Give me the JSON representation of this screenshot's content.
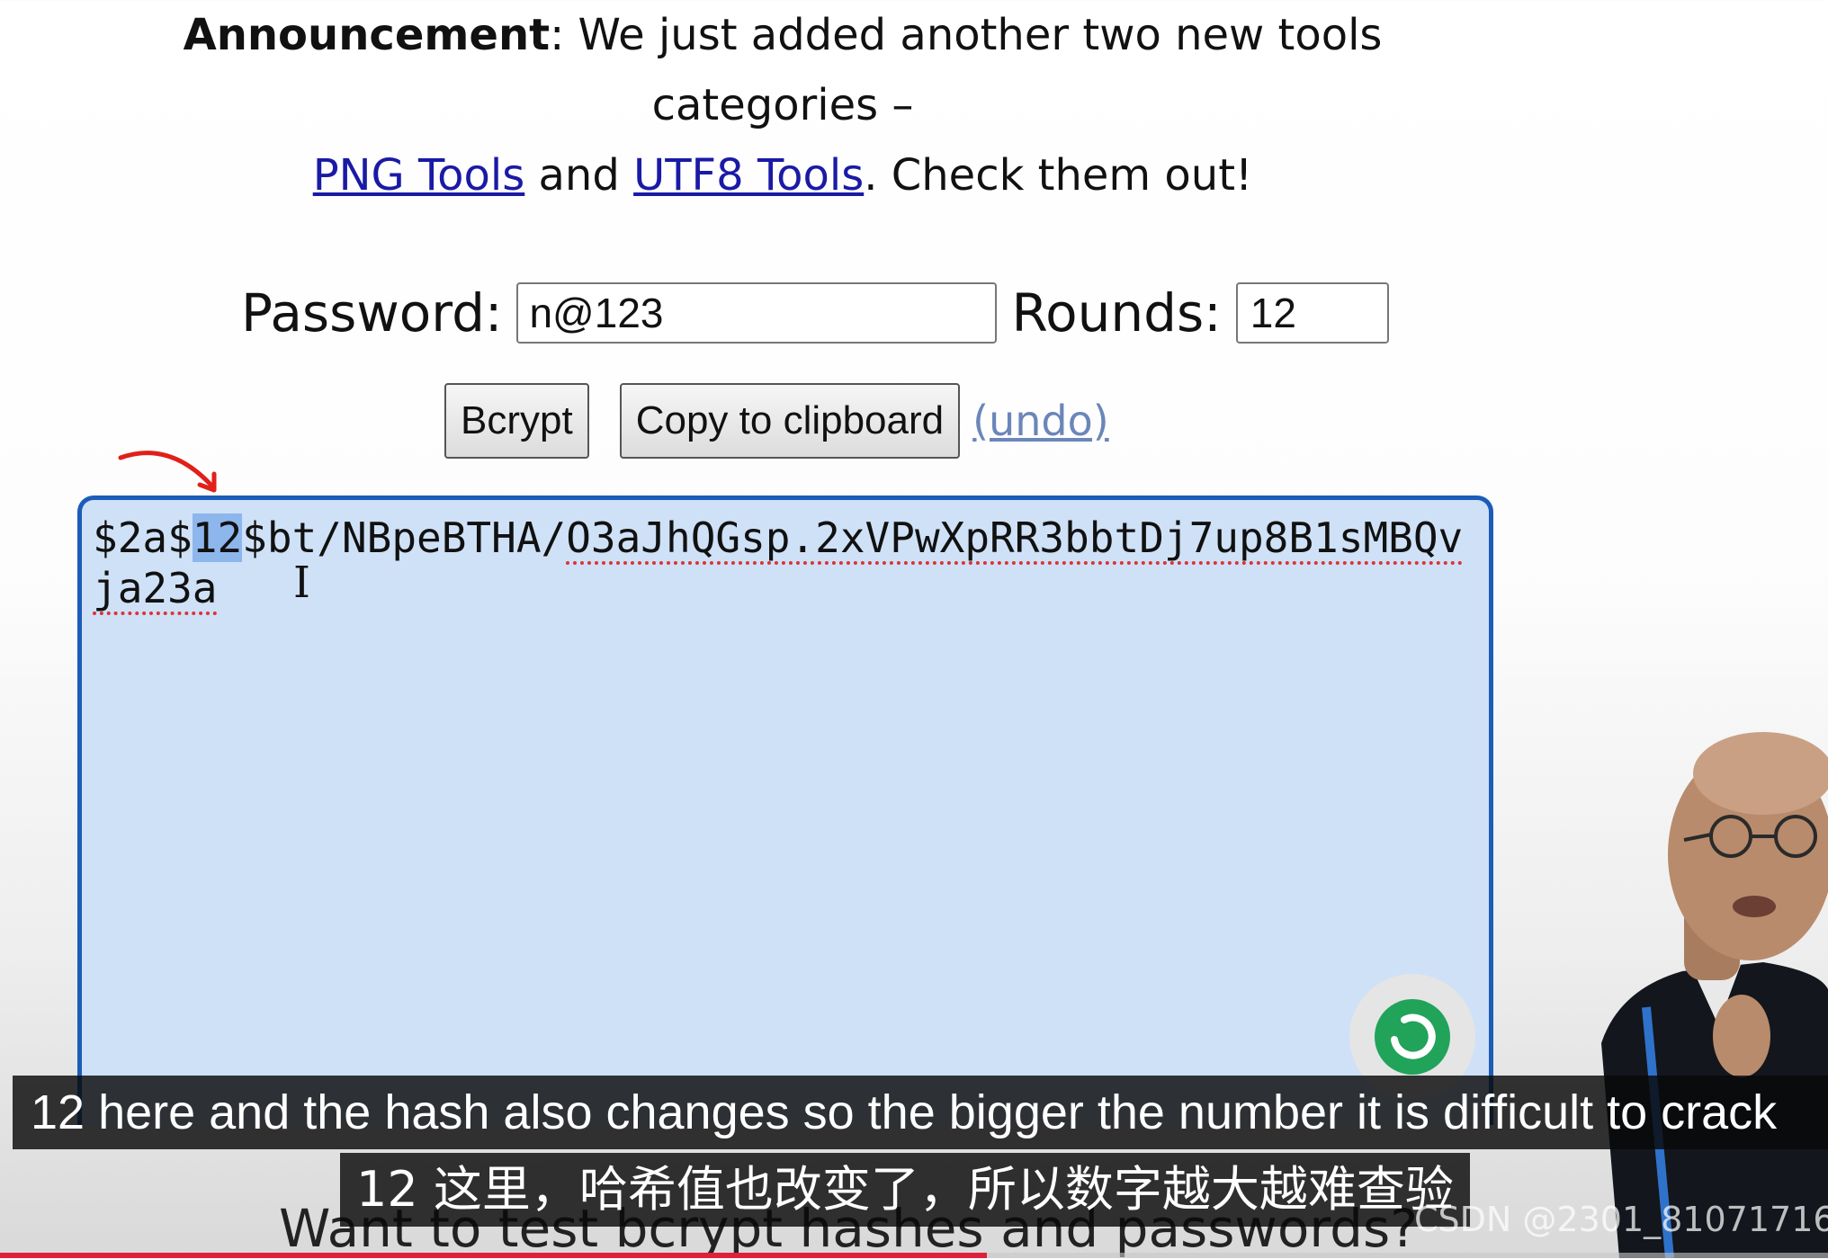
{
  "announcement": {
    "label": "Announcement",
    "text_1": ": We just added another two new tools",
    "text_2": "categories –",
    "link_png": "PNG Tools",
    "and": "and",
    "link_utf8": "UTF8 Tools",
    "text_3": ". Check them out!"
  },
  "form": {
    "password_label": "Password:",
    "password_value": "n@123",
    "rounds_label": "Rounds:",
    "rounds_value": "12",
    "bcrypt_button": "Bcrypt",
    "copy_button": "Copy to clipboard",
    "undo_link": "(undo)"
  },
  "output": {
    "prefix": "$2a$",
    "rounds": "12",
    "sep": "$",
    "plain": "bt/NBpeBTHA/",
    "hash_1": "O3aJhQGsp.2xVPwXpRR3bbtDj7up8B1sMBQv",
    "hash_2": "ja23a"
  },
  "subtitles": {
    "english": "12 here and the hash also changes so the bigger the number it is difficult to crack",
    "chinese": "12 这里，哈希值也改变了，所以数字越大越难查验"
  },
  "page": {
    "bottom_heading": "Want to test bcrypt hashes and passwords?"
  },
  "watermark": "CSDN @2301_81071716",
  "video": {
    "progress": 0.54
  },
  "colors": {
    "link": "#1a1aa6",
    "textarea_bg": "#cfe1f7",
    "textarea_border": "#1b5db8",
    "annotation_arrow": "#e0201a",
    "progress": "#e0203a"
  },
  "icons": [
    "annotation-arrow",
    "text-cursor-icon",
    "refresh-icon"
  ]
}
